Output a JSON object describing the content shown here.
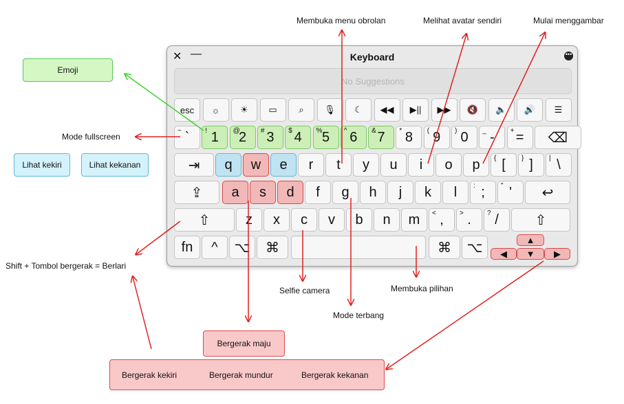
{
  "window": {
    "title": "Keyboard",
    "close_glyph": "✕",
    "minimize_glyph": "—",
    "more_glyph": "•••",
    "suggestions_placeholder": "No Suggestions"
  },
  "keyboard": {
    "fn_row": [
      "esc",
      "☼",
      "☀",
      "▭",
      "⌕",
      "🎙",
      "☾",
      "◀◀",
      "▶||",
      "▶▶",
      "🔇",
      "🔈",
      "🔊",
      "☰"
    ],
    "number_row": [
      {
        "main": "`",
        "sup": "~"
      },
      {
        "main": "1",
        "sup": "!"
      },
      {
        "main": "2",
        "sup": "@"
      },
      {
        "main": "3",
        "sup": "#"
      },
      {
        "main": "4",
        "sup": "$"
      },
      {
        "main": "5",
        "sup": "%"
      },
      {
        "main": "6",
        "sup": "^"
      },
      {
        "main": "7",
        "sup": "&"
      },
      {
        "main": "8",
        "sup": "*"
      },
      {
        "main": "9",
        "sup": "("
      },
      {
        "main": "0",
        "sup": ")"
      },
      {
        "main": "-",
        "sup": "_"
      },
      {
        "main": "=",
        "sup": "+"
      },
      {
        "main": "⌫",
        "sup": ""
      }
    ],
    "tab_row": [
      "⇥",
      "q",
      "w",
      "e",
      "r",
      "t",
      "y",
      "u",
      "i",
      "o",
      "p",
      {
        "main": "[",
        "sup": "{"
      },
      {
        "main": "]",
        "sup": "}"
      },
      {
        "main": "\\",
        "sup": "|"
      }
    ],
    "caps_row": [
      "⇪",
      "a",
      "s",
      "d",
      "f",
      "g",
      "h",
      "j",
      "k",
      "l",
      {
        "main": ";",
        "sup": ":"
      },
      {
        "main": "'",
        "sup": "\""
      },
      "↩"
    ],
    "shift_row": [
      "⇧",
      "z",
      "x",
      "c",
      "v",
      "b",
      "n",
      "m",
      {
        "main": ",",
        "sup": "<"
      },
      {
        "main": ".",
        "sup": ">"
      },
      {
        "main": "/",
        "sup": "?"
      },
      "⇧"
    ],
    "bottom_row": [
      "fn",
      "^",
      "⌥",
      "⌘",
      "",
      "⌘",
      "⌥"
    ],
    "arrows": [
      "▲",
      "◀",
      "▼",
      "▶"
    ]
  },
  "annotations": {
    "chat_menu": "Membuka menu obrolan",
    "own_avatar": "Melihat avatar sendiri",
    "start_drawing": "Mulai menggambar",
    "emoji": "Emoji",
    "fullscreen": "Mode fullscreen",
    "look_left": "Lihat kekiri",
    "look_right": "Lihat kekanan",
    "run": "Shift + Tombol bergerak  = Berlari",
    "selfie": "Selfie camera",
    "options": "Membuka pilihan",
    "fly_mode": "Mode terbang",
    "move_forward": "Bergerak maju",
    "move_left": "Bergerak kekiri",
    "move_back": "Bergerak mundur",
    "move_right": "Bergerak kekanan"
  },
  "colors": {
    "arrow_red": "#e02020",
    "arrow_green": "#3ad42a",
    "highlight_green": "#cdeeb6",
    "highlight_blue": "#bfe3f3",
    "highlight_red": "#f2b8b8"
  }
}
